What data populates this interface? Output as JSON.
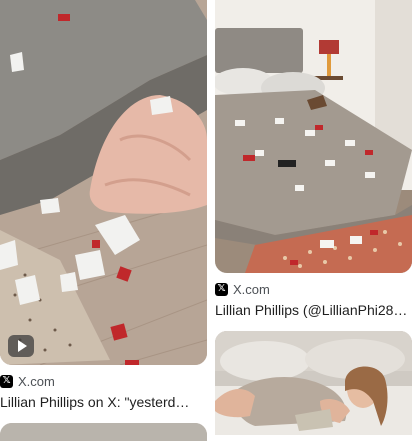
{
  "results": [
    {
      "source": "X.com",
      "source_icon": "x-logo-icon",
      "title": "Lillian Phillips on X: \"yesterd…",
      "has_video": true
    },
    {
      "source": "X.com",
      "source_icon": "x-logo-icon",
      "title": "Lillian Phillips (@LillianPhi28…",
      "has_video": false
    },
    {
      "has_video": false
    },
    {
      "has_video": false
    }
  ],
  "x_logo_glyph": "𝕏",
  "colors": {
    "title": "#1f1f1f",
    "source": "#4d5156"
  }
}
